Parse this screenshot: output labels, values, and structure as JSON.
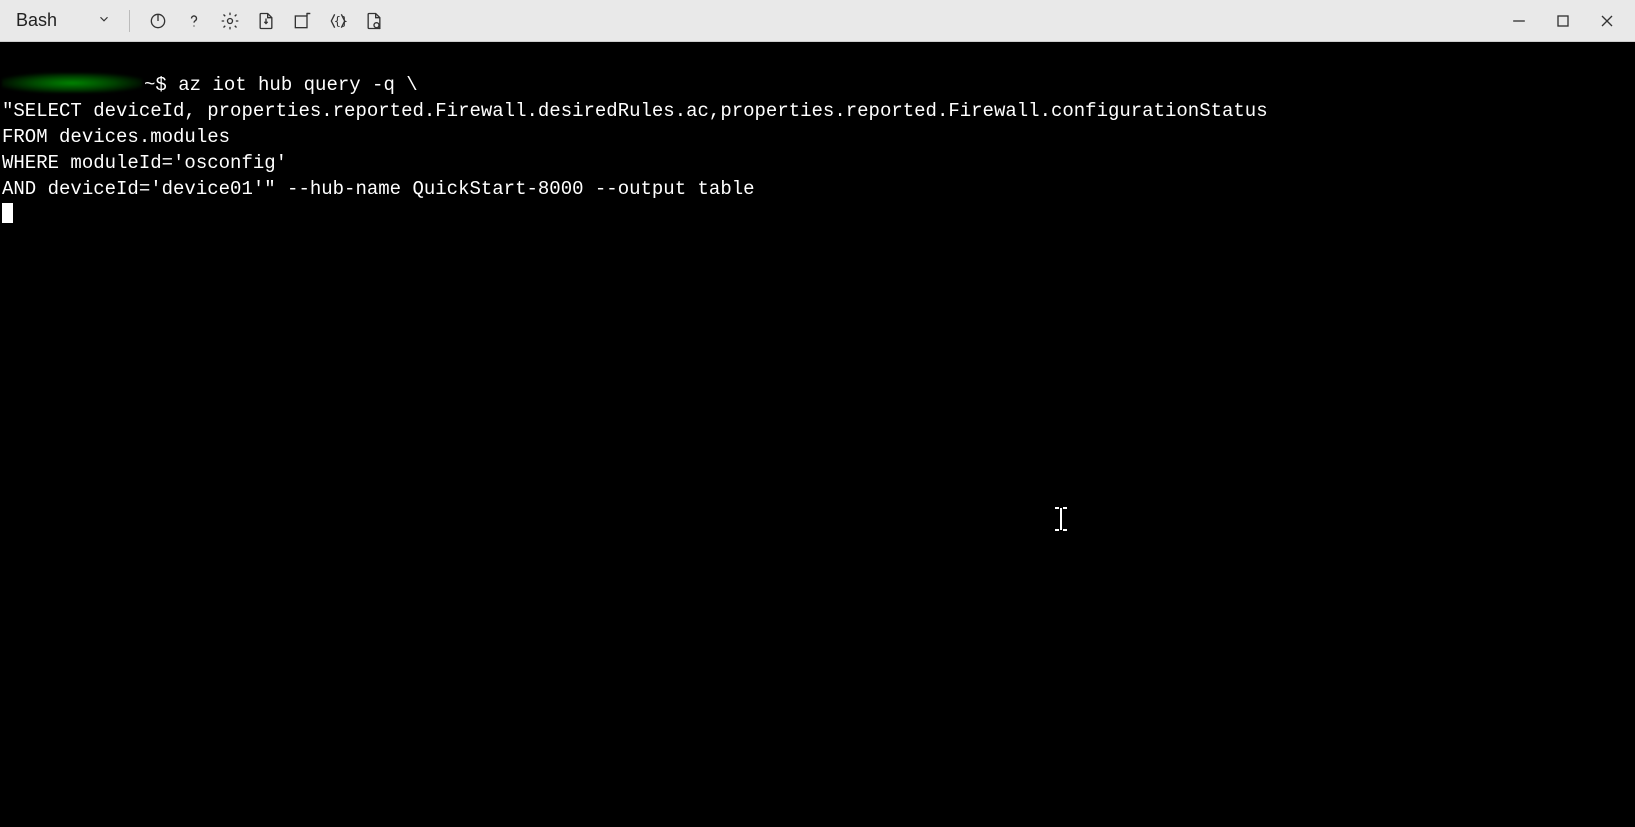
{
  "toolbar": {
    "shell_label": "Bash"
  },
  "terminal": {
    "prompt_suffix": "~$ ",
    "cmd_line1": "az iot hub query -q \\",
    "cmd_line2": "\"SELECT deviceId, properties.reported.Firewall.desiredRules.ac,properties.reported.Firewall.configurationStatus",
    "cmd_line3": "FROM devices.modules",
    "cmd_line4": "WHERE moduleId='osconfig'",
    "cmd_line5": "AND deviceId='device01'\" --hub-name QuickStart-8000 --output table"
  }
}
